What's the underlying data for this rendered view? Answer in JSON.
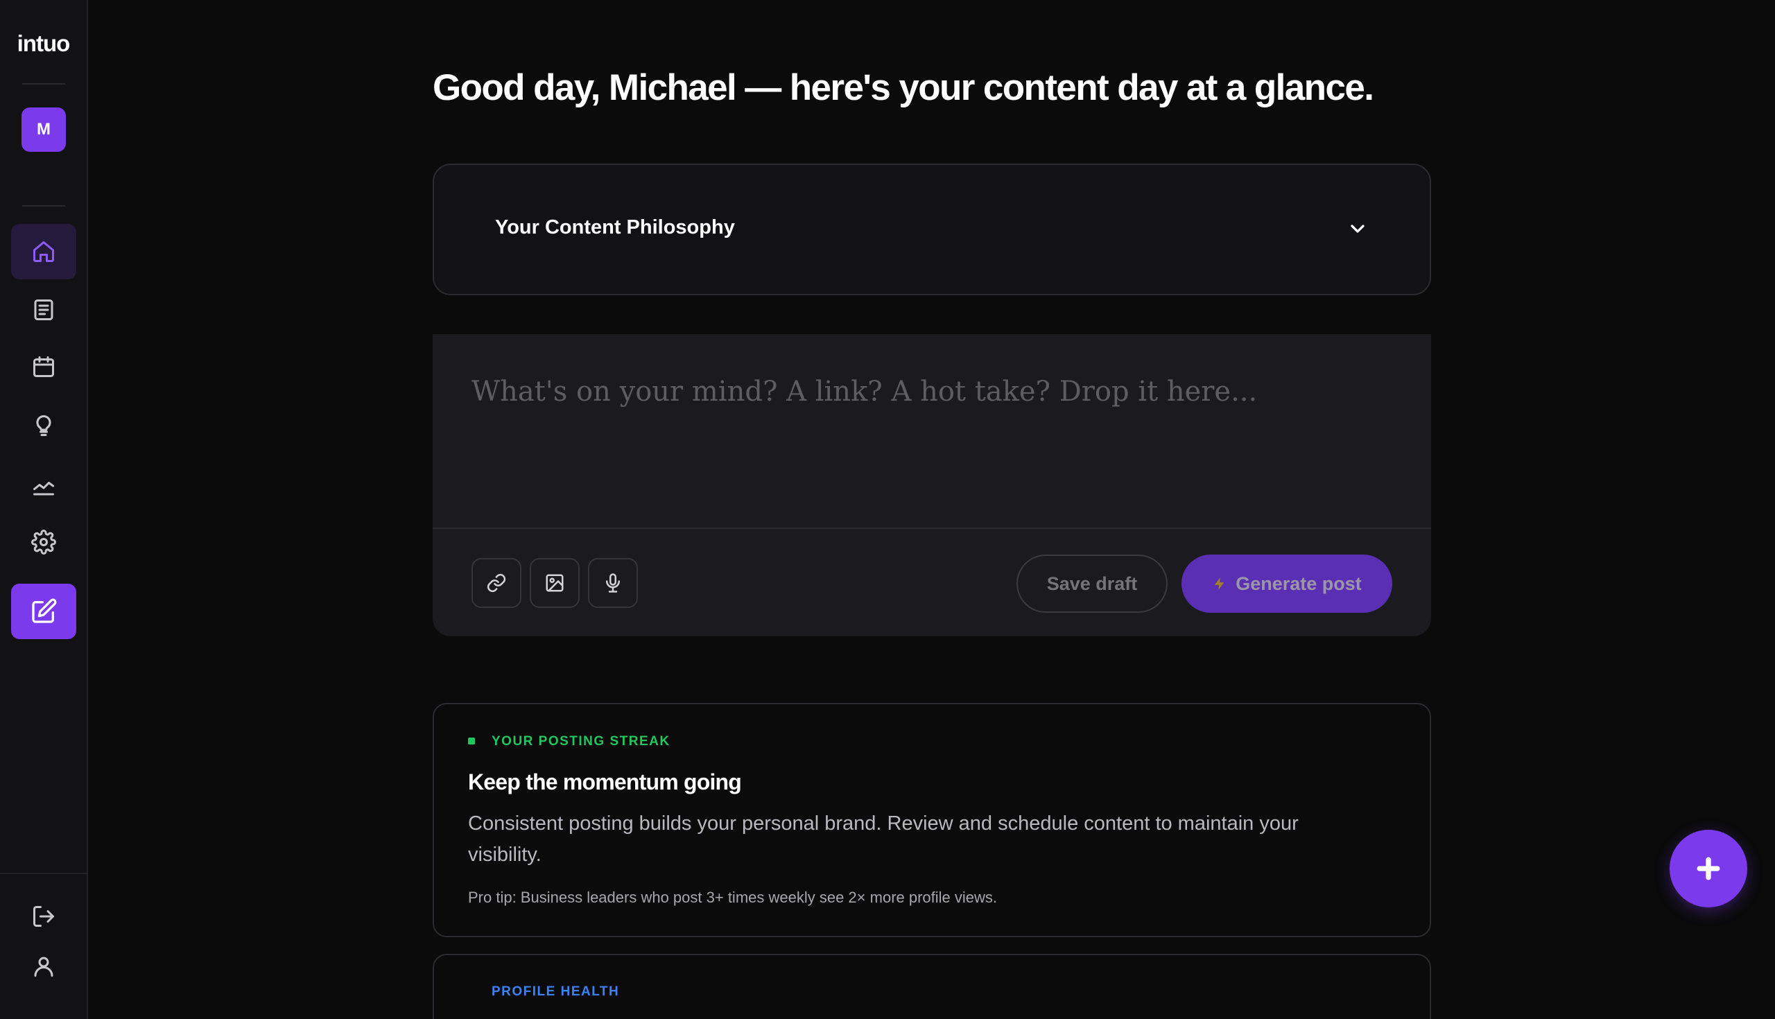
{
  "app": {
    "logo": "intuo"
  },
  "user": {
    "initial": "M"
  },
  "sidebar": {
    "items": [
      {
        "name": "home",
        "icon": "home-icon",
        "active": true
      },
      {
        "name": "posts",
        "icon": "document-icon"
      },
      {
        "name": "calendar",
        "icon": "calendar-icon"
      },
      {
        "name": "ideas",
        "icon": "lightbulb-icon"
      },
      {
        "name": "analytics",
        "icon": "chart-line-icon"
      },
      {
        "name": "settings",
        "icon": "gear-icon"
      },
      {
        "name": "compose",
        "icon": "edit-icon"
      }
    ],
    "bottom": [
      {
        "name": "logout",
        "icon": "logout-icon"
      },
      {
        "name": "profile",
        "icon": "user-icon"
      }
    ]
  },
  "main": {
    "greeting": "Good day, Michael — here's your content day at a glance.",
    "philosophy": {
      "title": "Your Content Philosophy"
    },
    "composer": {
      "placeholder": "What's on your mind? A link? A hot take? Drop it here...",
      "save_label": "Save draft",
      "generate_label": "Generate post"
    },
    "streak_card": {
      "kicker": "YOUR POSTING STREAK",
      "title": "Keep the momentum going",
      "body": "Consistent posting builds your personal brand. Review and schedule content to maintain your visibility.",
      "tip": "Pro tip: Business leaders who post 3+ times weekly see 2× more profile views."
    },
    "health_card": {
      "kicker": "PROFILE HEALTH"
    }
  },
  "colors": {
    "accent": "#7c3aed",
    "streak_green": "#22c55e",
    "health_blue": "#3b82f6",
    "background": "#0b0b0c"
  }
}
